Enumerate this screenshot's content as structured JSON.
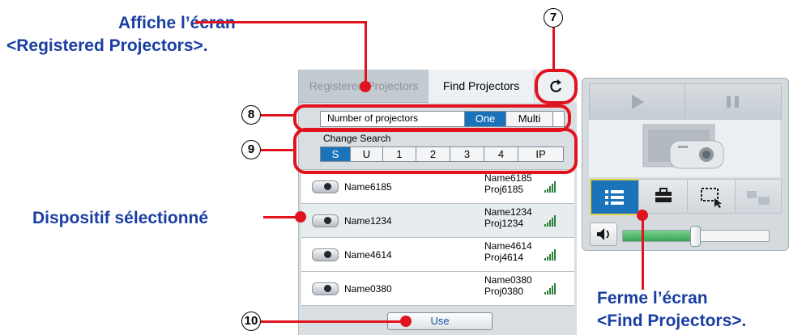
{
  "callouts": {
    "registered_line1": "Affiche l’écran",
    "registered_line2": "<Registered Projectors>.",
    "selected_device": "Dispositif sélectionné",
    "close_line1": "Ferme l’écran",
    "close_line2": "<Find Projectors>."
  },
  "markers": {
    "m7": "7",
    "m8": "8",
    "m9": "9",
    "m10": "10"
  },
  "tabs": {
    "registered": "Registered Projectors",
    "find": "Find Projectors"
  },
  "number_of_projectors": {
    "label": "Number of projectors",
    "options": [
      "One",
      "Multi"
    ],
    "selected": "One"
  },
  "change_search": {
    "label": "Change Search",
    "options": [
      "S",
      "U",
      "1",
      "2",
      "3",
      "4",
      "IP"
    ],
    "selected": "S"
  },
  "projectors": [
    {
      "name": "Name6185",
      "detail_name": "Name6185",
      "detail_proj": "Proj6185"
    },
    {
      "name": "Name1234",
      "detail_name": "Name1234",
      "detail_proj": "Proj1234"
    },
    {
      "name": "Name4614",
      "detail_name": "Name4614",
      "detail_proj": "Proj4614"
    },
    {
      "name": "Name0380",
      "detail_name": "Name0380",
      "detail_proj": "Proj0380"
    }
  ],
  "use_button": "Use",
  "colors": {
    "accent": "#1b73ba",
    "callout_text": "#1a3fa3",
    "highlight": "#e0141e"
  }
}
